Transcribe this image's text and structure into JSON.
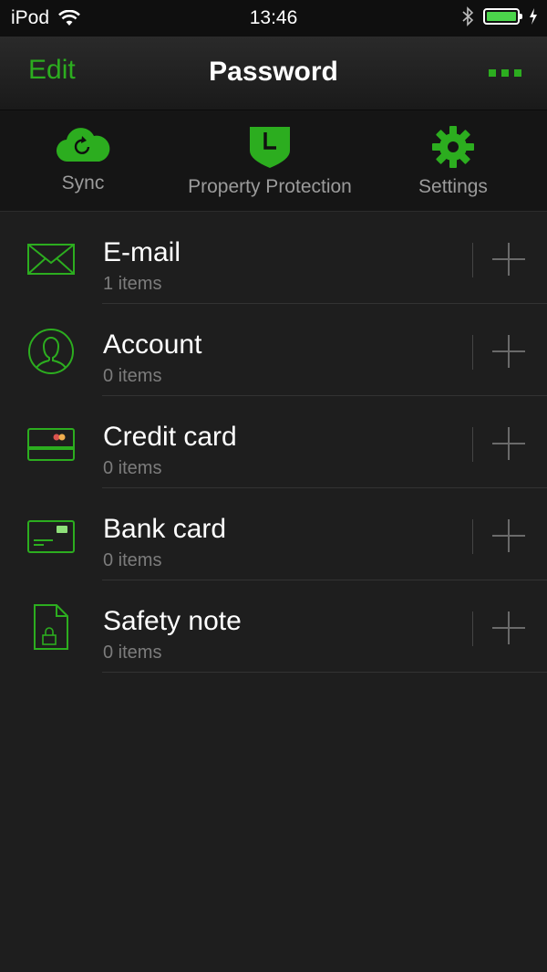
{
  "status_bar": {
    "carrier": "iPod",
    "time": "13:46",
    "battery_level": 1.0
  },
  "nav": {
    "edit_label": "Edit",
    "title": "Password",
    "more_icon": "more-icon"
  },
  "tabs": [
    {
      "label": "Sync",
      "icon": "cloud-sync-icon"
    },
    {
      "label": "Property Protection",
      "icon": "shield-clock-icon"
    },
    {
      "label": "Settings",
      "icon": "gear-icon"
    }
  ],
  "categories": [
    {
      "title": "E-mail",
      "count": "1 items",
      "icon": "envelope-icon"
    },
    {
      "title": "Account",
      "count": "0 items",
      "icon": "person-icon"
    },
    {
      "title": "Credit card",
      "count": "0 items",
      "icon": "credit-card-icon"
    },
    {
      "title": "Bank card",
      "count": "0 items",
      "icon": "bank-card-icon"
    },
    {
      "title": "Safety note",
      "count": "0 items",
      "icon": "locked-note-icon"
    }
  ],
  "colors": {
    "accent": "#2cad1f",
    "background": "#1e1e1e"
  }
}
